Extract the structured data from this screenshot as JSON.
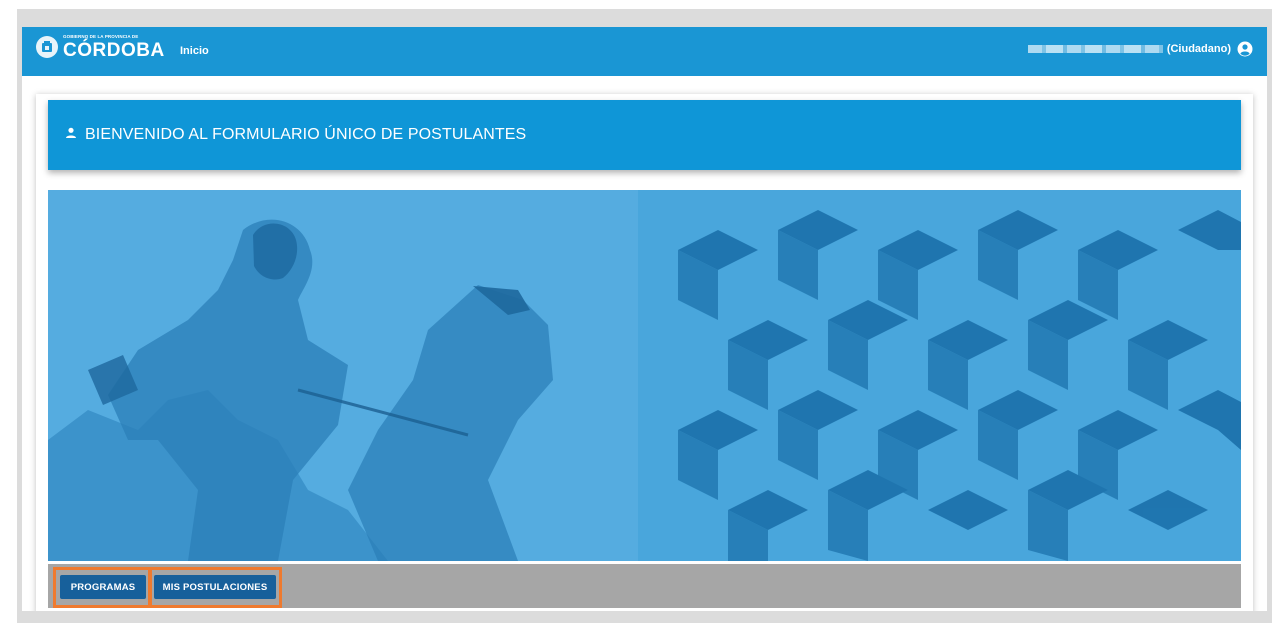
{
  "header": {
    "logo_small": "GOBIERNO DE LA PROVINCIA DE",
    "logo_big": "CÓRDOBA",
    "nav_inicio": "Inicio",
    "user_role": "(Ciudadano)"
  },
  "welcome": {
    "title": "BIENVENIDO AL FORMULARIO ÚNICO DE POSTULANTES"
  },
  "actions": {
    "programas": "PROGRAMAS",
    "mis_postulaciones": "MIS POSTULACIONES"
  },
  "icons": {
    "user": "user-circle-icon",
    "person": "person-icon",
    "seal": "province-seal-icon"
  },
  "colors": {
    "topbar": "#1a96d4",
    "welcome_bar": "#0f96d7",
    "button": "#17609b",
    "highlight": "#ef7a2e",
    "button_bar": "#a6a6a6"
  }
}
